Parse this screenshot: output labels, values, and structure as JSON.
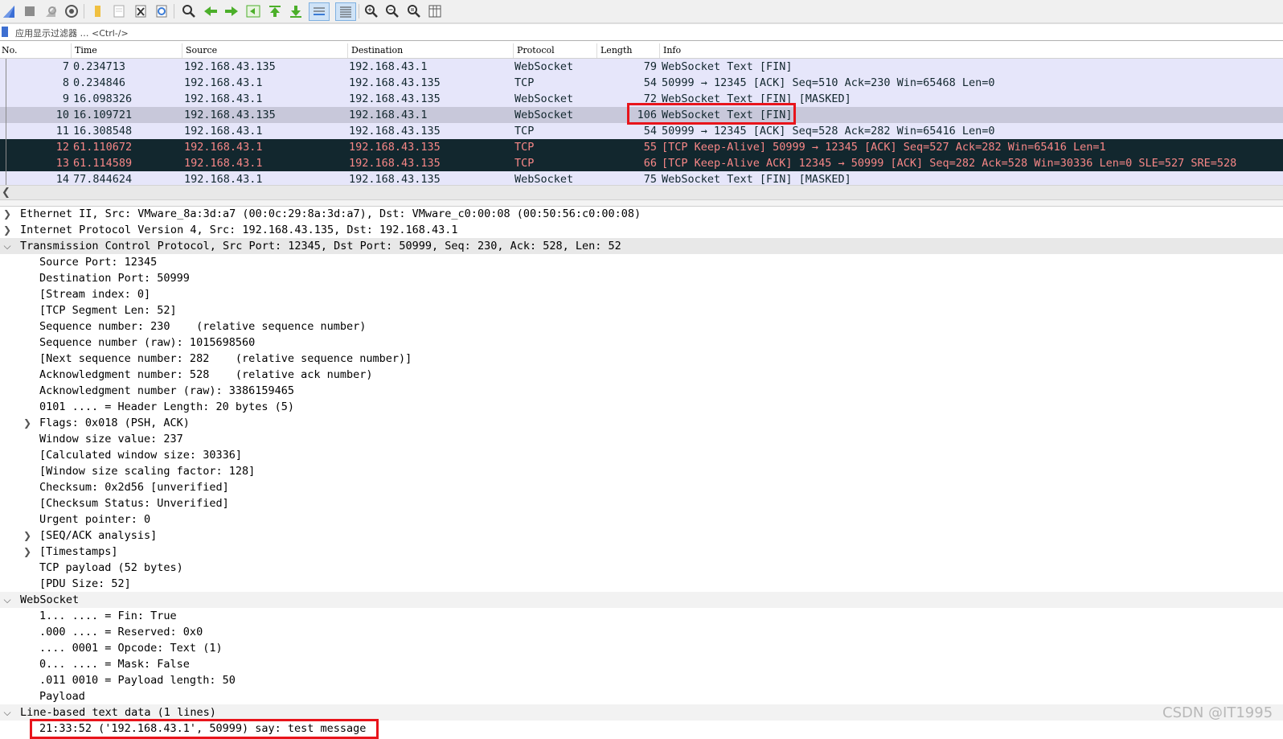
{
  "colors": {
    "websocket_row_bg": "#e6e6fa",
    "selected_row_bg": "#c8c8da",
    "tcp_keepalive_row_bg": "#12272e",
    "tcp_keepalive_row_fg": "#f78787",
    "annotation_red": "#e8141b"
  },
  "toolbar": {
    "icons": [
      "shark-fin-start-icon",
      "stop-icon",
      "restart-icon",
      "capture-options-icon",
      "open-file-icon",
      "save-file-icon",
      "close-file-icon",
      "reload-icon",
      "find-icon",
      "go-back-icon",
      "go-forward-icon",
      "go-to-packet-icon",
      "go-first-icon",
      "go-last-icon",
      "autoscroll-icon",
      "colorize-icon",
      "zoom-in-icon",
      "zoom-out-icon",
      "zoom-normal-icon",
      "resize-columns-icon"
    ]
  },
  "filter": {
    "placeholder": "应用显示过滤器 … <Ctrl-/>"
  },
  "packet_list": {
    "columns": [
      "No.",
      "Time",
      "Source",
      "Destination",
      "Protocol",
      "Length",
      "Info"
    ],
    "rows": [
      {
        "no": "7",
        "time": "0.234713",
        "src": "192.168.43.135",
        "dst": "192.168.43.1",
        "proto": "WebSocket",
        "len": "79",
        "info": "WebSocket Text [FIN]",
        "style": "ws"
      },
      {
        "no": "8",
        "time": "0.234846",
        "src": "192.168.43.1",
        "dst": "192.168.43.135",
        "proto": "TCP",
        "len": "54",
        "info": "50999 → 12345 [ACK] Seq=510 Ack=230 Win=65468 Len=0",
        "style": "ws"
      },
      {
        "no": "9",
        "time": "16.098326",
        "src": "192.168.43.1",
        "dst": "192.168.43.135",
        "proto": "WebSocket",
        "len": "72",
        "info": "WebSocket Text [FIN] [MASKED]",
        "style": "ws"
      },
      {
        "no": "10",
        "time": "16.109721",
        "src": "192.168.43.135",
        "dst": "192.168.43.1",
        "proto": "WebSocket",
        "len": "106",
        "info": "WebSocket Text [FIN]",
        "style": "sel"
      },
      {
        "no": "11",
        "time": "16.308548",
        "src": "192.168.43.1",
        "dst": "192.168.43.135",
        "proto": "TCP",
        "len": "54",
        "info": "50999 → 12345 [ACK] Seq=528 Ack=282 Win=65416 Len=0",
        "style": "ws"
      },
      {
        "no": "12",
        "time": "61.110672",
        "src": "192.168.43.1",
        "dst": "192.168.43.135",
        "proto": "TCP",
        "len": "55",
        "info": "[TCP Keep-Alive] 50999 → 12345 [ACK] Seq=527 Ack=282 Win=65416 Len=1",
        "style": "dark"
      },
      {
        "no": "13",
        "time": "61.114589",
        "src": "192.168.43.1",
        "dst": "192.168.43.135",
        "proto": "TCP",
        "len": "66",
        "info": "[TCP Keep-Alive ACK] 12345 → 50999 [ACK] Seq=282 Ack=528 Win=30336 Len=0 SLE=527 SRE=528",
        "style": "dark"
      },
      {
        "no": "14",
        "time": "77.844624",
        "src": "192.168.43.1",
        "dst": "192.168.43.135",
        "proto": "WebSocket",
        "len": "75",
        "info": "WebSocket Text [FIN] [MASKED]",
        "style": "ws"
      }
    ]
  },
  "details": [
    {
      "text": "Ethernet II, Src: VMware_8a:3d:a7 (00:0c:29:8a:3d:a7), Dst: VMware_c0:00:08 (00:50:56:c0:00:08)",
      "level": 0,
      "arrow": "collapsed"
    },
    {
      "text": "Internet Protocol Version 4, Src: 192.168.43.135, Dst: 192.168.43.1",
      "level": 0,
      "arrow": "collapsed"
    },
    {
      "text": "Transmission Control Protocol, Src Port: 12345, Dst Port: 50999, Seq: 230, Ack: 528, Len: 52",
      "level": 0,
      "arrow": "expanded",
      "hl": "hl"
    },
    {
      "text": "Source Port: 12345",
      "level": 1,
      "arrow": ""
    },
    {
      "text": "Destination Port: 50999",
      "level": 1,
      "arrow": ""
    },
    {
      "text": "[Stream index: 0]",
      "level": 1,
      "arrow": ""
    },
    {
      "text": "[TCP Segment Len: 52]",
      "level": 1,
      "arrow": ""
    },
    {
      "text": "Sequence number: 230    (relative sequence number)",
      "level": 1,
      "arrow": ""
    },
    {
      "text": "Sequence number (raw): 1015698560",
      "level": 1,
      "arrow": ""
    },
    {
      "text": "[Next sequence number: 282    (relative sequence number)]",
      "level": 1,
      "arrow": ""
    },
    {
      "text": "Acknowledgment number: 528    (relative ack number)",
      "level": 1,
      "arrow": ""
    },
    {
      "text": "Acknowledgment number (raw): 3386159465",
      "level": 1,
      "arrow": ""
    },
    {
      "text": "0101 .... = Header Length: 20 bytes (5)",
      "level": 1,
      "arrow": ""
    },
    {
      "text": "Flags: 0x018 (PSH, ACK)",
      "level": 1,
      "arrow": "collapsed"
    },
    {
      "text": "Window size value: 237",
      "level": 1,
      "arrow": ""
    },
    {
      "text": "[Calculated window size: 30336]",
      "level": 1,
      "arrow": ""
    },
    {
      "text": "[Window size scaling factor: 128]",
      "level": 1,
      "arrow": ""
    },
    {
      "text": "Checksum: 0x2d56 [unverified]",
      "level": 1,
      "arrow": ""
    },
    {
      "text": "[Checksum Status: Unverified]",
      "level": 1,
      "arrow": ""
    },
    {
      "text": "Urgent pointer: 0",
      "level": 1,
      "arrow": ""
    },
    {
      "text": "[SEQ/ACK analysis]",
      "level": 1,
      "arrow": "collapsed"
    },
    {
      "text": "[Timestamps]",
      "level": 1,
      "arrow": "collapsed"
    },
    {
      "text": "TCP payload (52 bytes)",
      "level": 1,
      "arrow": ""
    },
    {
      "text": "[PDU Size: 52]",
      "level": 1,
      "arrow": ""
    },
    {
      "text": "WebSocket",
      "level": 0,
      "arrow": "expanded",
      "hl": "hl2"
    },
    {
      "text": "1... .... = Fin: True",
      "level": 1,
      "arrow": ""
    },
    {
      "text": ".000 .... = Reserved: 0x0",
      "level": 1,
      "arrow": ""
    },
    {
      "text": ".... 0001 = Opcode: Text (1)",
      "level": 1,
      "arrow": ""
    },
    {
      "text": "0... .... = Mask: False",
      "level": 1,
      "arrow": ""
    },
    {
      "text": ".011 0010 = Payload length: 50",
      "level": 1,
      "arrow": ""
    },
    {
      "text": "Payload",
      "level": 1,
      "arrow": ""
    },
    {
      "text": "Line-based text data (1 lines)",
      "level": 0,
      "arrow": "expanded",
      "hl": "hl2"
    },
    {
      "text": "21:33:52 ('192.168.43.1', 50999) say: test message",
      "level": 1,
      "arrow": ""
    }
  ],
  "watermark": "CSDN @IT1995"
}
